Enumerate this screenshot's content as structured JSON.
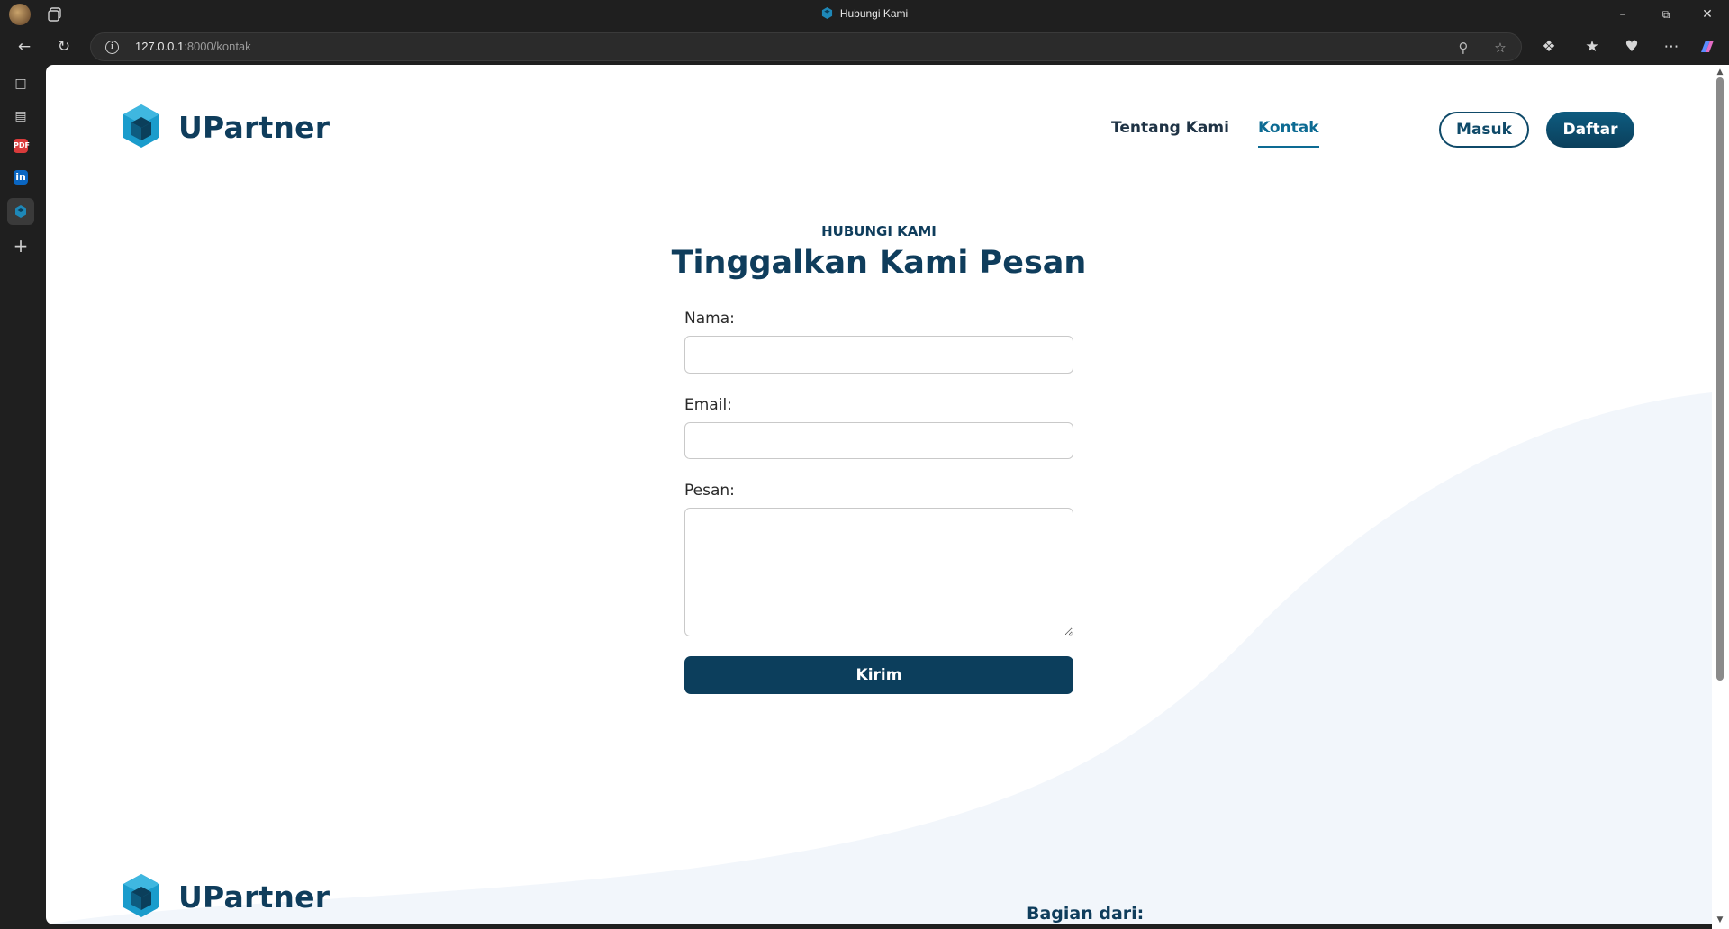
{
  "browser": {
    "tab_title": "Hubungi Kami",
    "url_host": "127.0.0.1",
    "url_rest": ":8000/kontak",
    "window_controls": [
      "minimize-icon",
      "restore-icon",
      "close-icon"
    ]
  },
  "header": {
    "brand": "UPartner",
    "nav": [
      {
        "label": "Tentang Kami",
        "active": false
      },
      {
        "label": "Kontak",
        "active": true
      }
    ],
    "login_label": "Masuk",
    "register_label": "Daftar"
  },
  "contact": {
    "eyebrow": "HUBUNGI KAMI",
    "title": "Tinggalkan Kami Pesan",
    "name_label": "Nama:",
    "name_value": "",
    "email_label": "Email:",
    "email_value": "",
    "message_label": "Pesan:",
    "message_value": "",
    "submit_label": "Kirim"
  },
  "footer": {
    "brand": "UPartner",
    "part_of_label": "Bagian dari:"
  },
  "colors": {
    "brand_dark": "#0f3d5c",
    "accent": "#0d6b93",
    "wave": "#f2f6fb"
  }
}
